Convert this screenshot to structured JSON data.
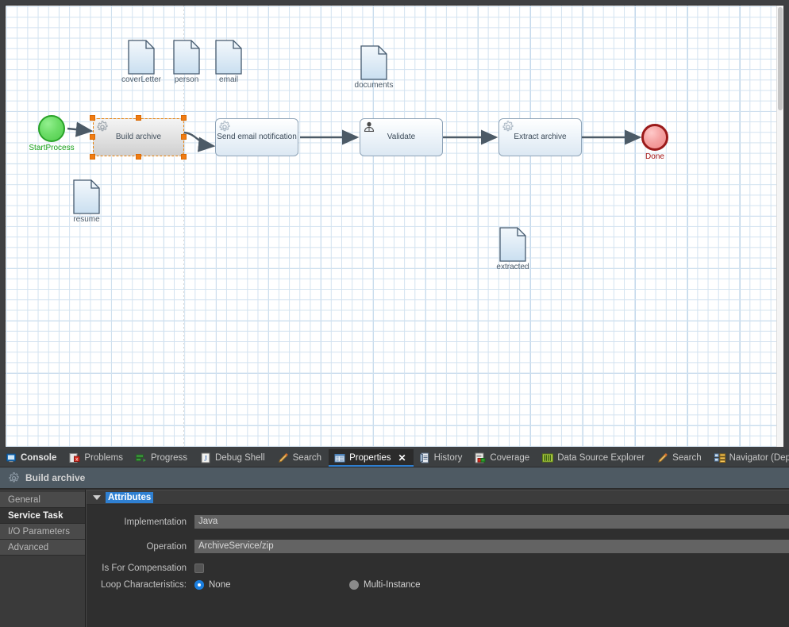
{
  "canvas": {
    "start_event": {
      "label": "StartProcess",
      "icon": "start-event-icon"
    },
    "end_event": {
      "label": "Done",
      "icon": "end-event-icon"
    },
    "tasks": [
      {
        "label": "Build archive",
        "type": "service-task",
        "marker": "gear-icon",
        "selected": true
      },
      {
        "label": "Send email notification",
        "type": "service-task",
        "marker": "gear-icon",
        "selected": false
      },
      {
        "label": "Validate",
        "type": "user-task",
        "marker": "user-icon",
        "selected": false
      },
      {
        "label": "Extract archive",
        "type": "service-task",
        "marker": "gear-icon",
        "selected": false
      }
    ],
    "data_objects": [
      {
        "label": "coverLetter"
      },
      {
        "label": "person"
      },
      {
        "label": "email"
      },
      {
        "label": "documents"
      },
      {
        "label": "resume"
      },
      {
        "label": "extracted"
      }
    ],
    "colors": {
      "grid_line": "#d2e2f0",
      "grid_major": "#bfd6ea",
      "start_fill": "#6ddd68",
      "start_border": "#29a329",
      "start_label": "#18a018",
      "end_fill": "#f5a3a3",
      "end_border": "#9a1a1a",
      "end_label": "#a31414",
      "task_border": "#8fa4b8",
      "selection_handle": "#f07c12",
      "flow_line": "#4c5a66"
    }
  },
  "dock": {
    "tabs": [
      {
        "label": "Console",
        "icon": "console-icon",
        "active": false,
        "bold": true
      },
      {
        "label": "Problems",
        "icon": "problems-icon",
        "active": false,
        "bold": false
      },
      {
        "label": "Progress",
        "icon": "progress-icon",
        "active": false,
        "bold": false
      },
      {
        "label": "Debug Shell",
        "icon": "debug-shell-icon",
        "active": false,
        "bold": false
      },
      {
        "label": "Search",
        "icon": "search-icon",
        "active": false,
        "bold": false
      },
      {
        "label": "Properties",
        "icon": "properties-icon",
        "active": true,
        "bold": false,
        "close": "✕"
      },
      {
        "label": "History",
        "icon": "history-icon",
        "active": false,
        "bold": false
      },
      {
        "label": "Coverage",
        "icon": "coverage-icon",
        "active": false,
        "bold": false
      },
      {
        "label": "Data Source Explorer",
        "icon": "data-source-explorer-icon",
        "active": false,
        "bold": false
      },
      {
        "label": "Search",
        "icon": "search-icon",
        "active": false,
        "bold": false
      },
      {
        "label": "Navigator (Deprecated)",
        "icon": "navigator-icon",
        "active": false,
        "bold": false
      }
    ],
    "view_header": {
      "title": "Build archive",
      "icon": "gear-icon"
    },
    "accent": "#2f7fd0"
  },
  "properties": {
    "tabs": [
      {
        "label": "General",
        "active": false
      },
      {
        "label": "Service Task",
        "active": true
      },
      {
        "label": "I/O Parameters",
        "active": false
      },
      {
        "label": "Advanced",
        "active": false
      }
    ],
    "section": {
      "title": "Attributes",
      "expanded": true
    },
    "fields": {
      "implementation": {
        "label": "Implementation",
        "value": "Java"
      },
      "operation": {
        "label": "Operation",
        "value": "ArchiveService/zip"
      },
      "is_for_compensation": {
        "label": "Is For Compensation",
        "checked": false
      },
      "loop_characteristics": {
        "label": "Loop Characteristics:",
        "options": [
          {
            "label": "None",
            "selected": true
          },
          {
            "label": "Multi-Instance",
            "selected": false
          }
        ]
      }
    }
  }
}
